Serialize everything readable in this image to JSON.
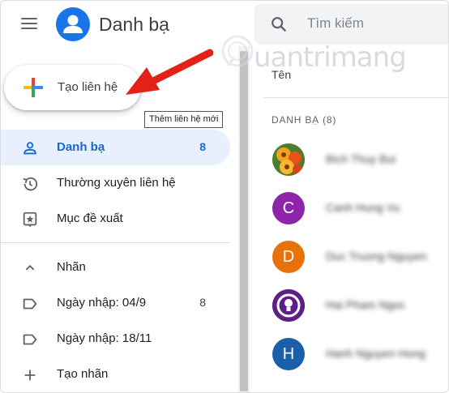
{
  "header": {
    "app_title": "Danh bạ",
    "search_placeholder": "Tìm kiếm"
  },
  "create_button": {
    "label": "Tạo liên hệ",
    "tooltip": "Thêm liên hệ mới"
  },
  "sidebar": {
    "items": [
      {
        "label": "Danh bạ",
        "count": "8",
        "icon": "person-icon",
        "active": true
      },
      {
        "label": "Thường xuyên liên hệ",
        "count": "",
        "icon": "history-icon"
      },
      {
        "label": "Mục đề xuất",
        "count": "",
        "icon": "suggestions-icon"
      }
    ],
    "labels_header": "Nhãn",
    "labels": [
      {
        "label": "Ngày nhập: 04/9",
        "count": "8",
        "icon": "label-icon"
      },
      {
        "label": "Ngày nhập: 18/11",
        "count": "",
        "icon": "label-icon"
      }
    ],
    "create_label": "Tạo nhãn"
  },
  "main": {
    "column_header": "Tên",
    "section_header": "DANH BẠ (8)",
    "contacts": [
      {
        "name": "Bich Thuy Bui",
        "initial": "",
        "color": "#f29900",
        "photo": true
      },
      {
        "name": "Canh Hung Vu",
        "initial": "C",
        "color": "#8e24aa"
      },
      {
        "name": "Duc Truong Nguyen",
        "initial": "D",
        "color": "#e8710a"
      },
      {
        "name": "Hai Pham Ngoc",
        "initial": "",
        "color": "#6a1b9a",
        "photo": true
      },
      {
        "name": "Hanh Nguyen Hong",
        "initial": "H",
        "color": "#1a5fa8"
      }
    ]
  },
  "colors": {
    "accent": "#1a73e8",
    "active_bg": "#e8f0fe",
    "arrow": "#e32119"
  },
  "watermark": {
    "text": "uantrimang"
  }
}
